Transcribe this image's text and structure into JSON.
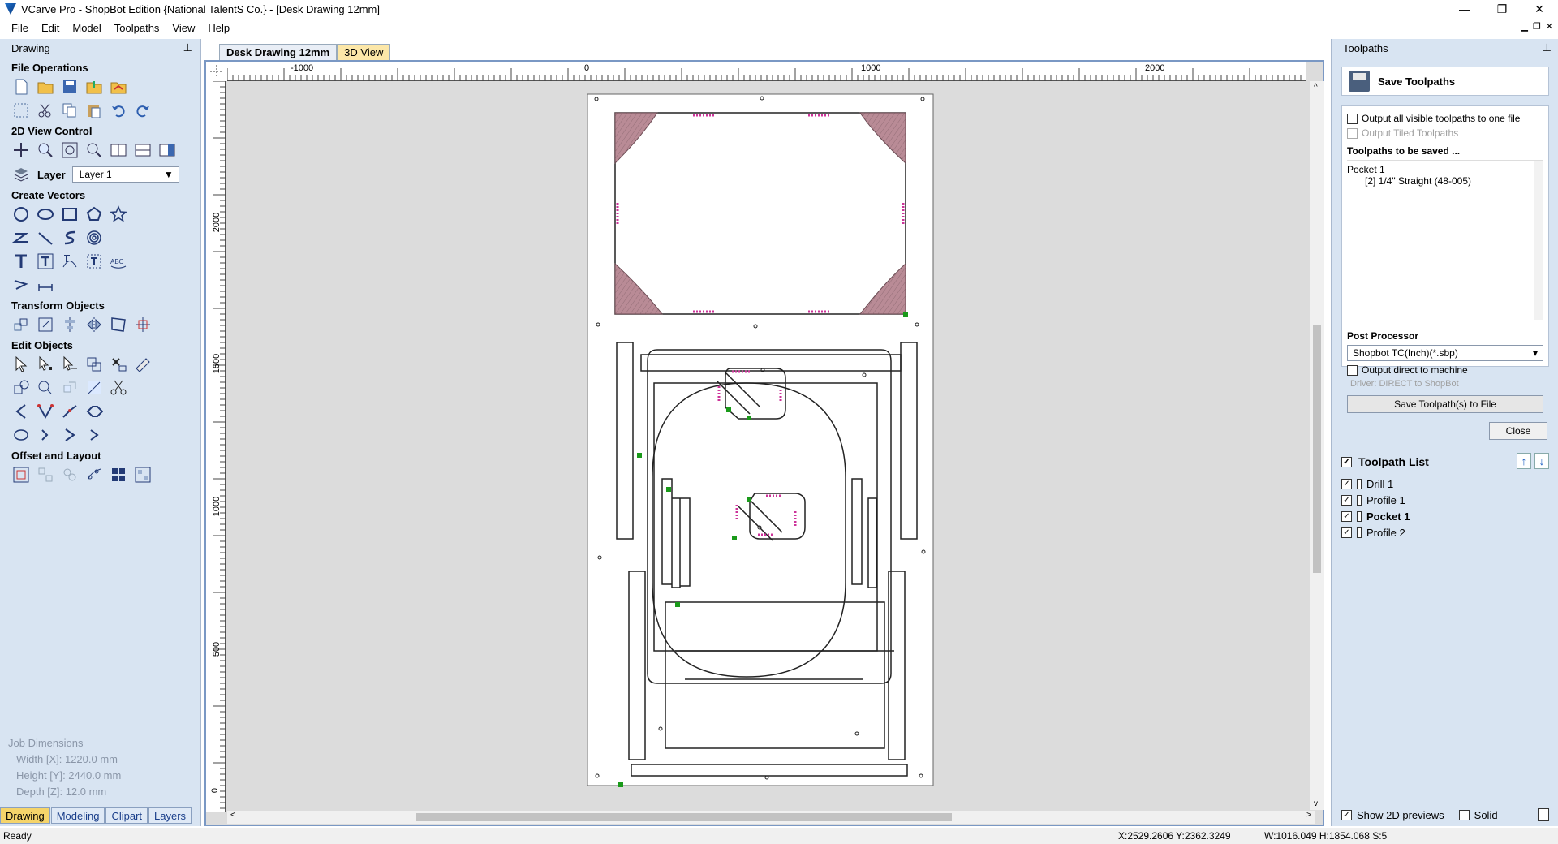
{
  "window": {
    "title": "VCarve Pro - ShopBot Edition {National TalentS Co.} - [Desk Drawing 12mm]",
    "minimize": "—",
    "maximize": "❐",
    "close": "✕"
  },
  "menu": [
    "File",
    "Edit",
    "Model",
    "Toolpaths",
    "View",
    "Help"
  ],
  "left_panel": {
    "title": "Drawing",
    "pin": "⊥",
    "sections": {
      "file_operations": "File Operations",
      "view_control": "2D View Control",
      "create_vectors": "Create Vectors",
      "transform_objects": "Transform Objects",
      "edit_objects": "Edit Objects",
      "offset_layout": "Offset and Layout"
    },
    "layer_label": "Layer",
    "layer_value": "Layer 1",
    "job_dimensions": {
      "title": "Job Dimensions",
      "width": "Width  [X]: 1220.0 mm",
      "height": "Height [Y]: 2440.0 mm",
      "depth": "Depth  [Z]: 12.0 mm"
    },
    "tabs": [
      "Drawing",
      "Modeling",
      "Clipart",
      "Layers"
    ]
  },
  "doc_tabs": [
    "Desk Drawing 12mm",
    "3D View"
  ],
  "rulers": {
    "top": [
      "-1000",
      "0",
      "1000",
      "2000"
    ],
    "left": [
      "2000",
      "1500",
      "1000",
      "500",
      "0"
    ]
  },
  "right_panel": {
    "title": "Toolpaths",
    "pin": "⊥",
    "save_title": "Save Toolpaths",
    "opt_all_visible": "Output all visible toolpaths to one file",
    "opt_tiled": "Output Tiled Toolpaths",
    "to_be_saved_title": "Toolpaths to be saved ...",
    "saved_item": "Pocket 1",
    "saved_tool": "[2] 1/4\" Straight  (48-005)",
    "post_processor_title": "Post Processor",
    "post_processor_value": "Shopbot TC(Inch)(*.sbp)",
    "output_direct": "Output direct to machine",
    "driver_text": "Driver: DIRECT to ShopBot",
    "save_file_button": "Save Toolpath(s) to File",
    "close_button": "Close",
    "toolpath_list_title": "Toolpath List",
    "toolpath_list": [
      {
        "name": "Drill 1",
        "bold": false
      },
      {
        "name": "Profile 1",
        "bold": false
      },
      {
        "name": "Pocket 1",
        "bold": true
      },
      {
        "name": "Profile 2",
        "bold": false
      }
    ],
    "show_previews": "Show 2D previews",
    "solid": "Solid"
  },
  "status": {
    "ready": "Ready",
    "coords": "X:2529.2606 Y:2362.3249",
    "dims": "W:1016.049   H:1854.068  S:5"
  },
  "colors": {
    "panel_bg": "#d8e4f2",
    "accent": "#1b5ec4",
    "pocket_fill": "#b98b96",
    "toolpath_magenta": "#cc3399",
    "node_green": "#1a9a1a"
  }
}
